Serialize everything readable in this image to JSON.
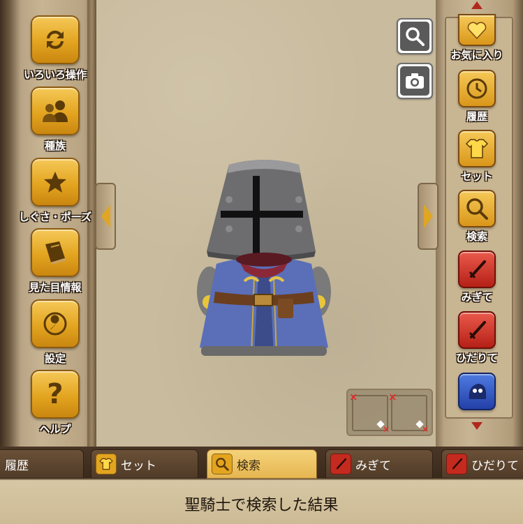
{
  "left_menu": [
    {
      "label": "いろいろ操作",
      "icon": "cycle-arrows-icon"
    },
    {
      "label": "種族",
      "icon": "race-people-icon"
    },
    {
      "label": "しぐさ・ポーズ",
      "icon": "star-icon"
    },
    {
      "label": "見た目情報",
      "icon": "book-icon"
    },
    {
      "label": "設定",
      "icon": "wrench-icon"
    },
    {
      "label": "ヘルプ",
      "icon": "question-icon"
    }
  ],
  "right_menu": [
    {
      "label": "お気に入り",
      "icon": "heart-icon"
    },
    {
      "label": "履歴",
      "icon": "history-clock-icon"
    },
    {
      "label": "セット",
      "icon": "clothes-set-icon"
    },
    {
      "label": "検索",
      "icon": "magnifier-icon"
    },
    {
      "label": "みぎて",
      "icon": "sword-icon"
    },
    {
      "label": "ひだりて",
      "icon": "sword-icon"
    },
    {
      "label": "",
      "icon": "blue-creature-icon"
    }
  ],
  "tools": [
    {
      "icon": "zoom-icon"
    },
    {
      "icon": "camera-icon"
    }
  ],
  "bottom_tabs": [
    {
      "label": "履歴",
      "icon": "history-clock-icon",
      "active": false
    },
    {
      "label": "セット",
      "icon": "clothes-set-icon",
      "active": false
    },
    {
      "label": "検索",
      "icon": "magnifier-icon",
      "active": true
    },
    {
      "label": "みぎて",
      "icon": "sword-icon",
      "active": false
    },
    {
      "label": "ひだりて",
      "icon": "sword-icon",
      "active": false
    }
  ],
  "status_message": "聖騎士で検索した結果",
  "colors": {
    "gold_button": "#e3a420",
    "red_button": "#c52a1e",
    "blue_button": "#2f55c2",
    "parchment": "#c9bb9d",
    "scroll_arrow": "#b0281c"
  }
}
